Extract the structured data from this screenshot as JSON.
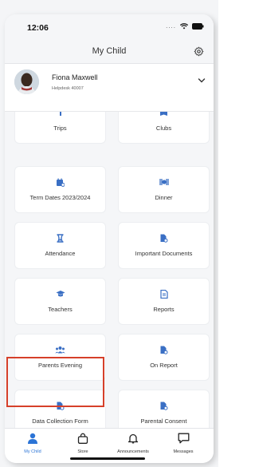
{
  "status_bar": {
    "time": "12:06"
  },
  "navbar": {
    "title": "My Child"
  },
  "profile": {
    "name": "Fiona Maxwell",
    "subtitle": "Helpdesk 40007"
  },
  "tiles": [
    {
      "label": "Trips",
      "icon": "trips-icon"
    },
    {
      "label": "Clubs",
      "icon": "clubs-icon"
    },
    {
      "label": "Term Dates 2023/2024",
      "icon": "calendar-icon"
    },
    {
      "label": "Dinner",
      "icon": "dinner-icon"
    },
    {
      "label": "Attendance",
      "icon": "attendance-icon"
    },
    {
      "label": "Important Documents",
      "icon": "document-icon"
    },
    {
      "label": "Teachers",
      "icon": "graduation-cap-icon"
    },
    {
      "label": "Reports",
      "icon": "report-icon"
    },
    {
      "label": "Parents Evening",
      "icon": "group-icon"
    },
    {
      "label": "On Report",
      "icon": "document-icon"
    },
    {
      "label": "Data Collection Form",
      "icon": "document-icon"
    },
    {
      "label": "Parental Consent",
      "icon": "document-icon"
    }
  ],
  "tabbar": {
    "items": [
      {
        "label": "My Child",
        "icon": "person-icon",
        "active": true
      },
      {
        "label": "Store",
        "icon": "shopping-bag-icon",
        "active": false
      },
      {
        "label": "Announcements",
        "icon": "bell-icon",
        "active": false
      },
      {
        "label": "Messages",
        "icon": "chat-icon",
        "active": false
      }
    ]
  },
  "colors": {
    "accent": "#2b74d6",
    "highlight": "#d6402a",
    "icon": "#3a6fc4"
  }
}
